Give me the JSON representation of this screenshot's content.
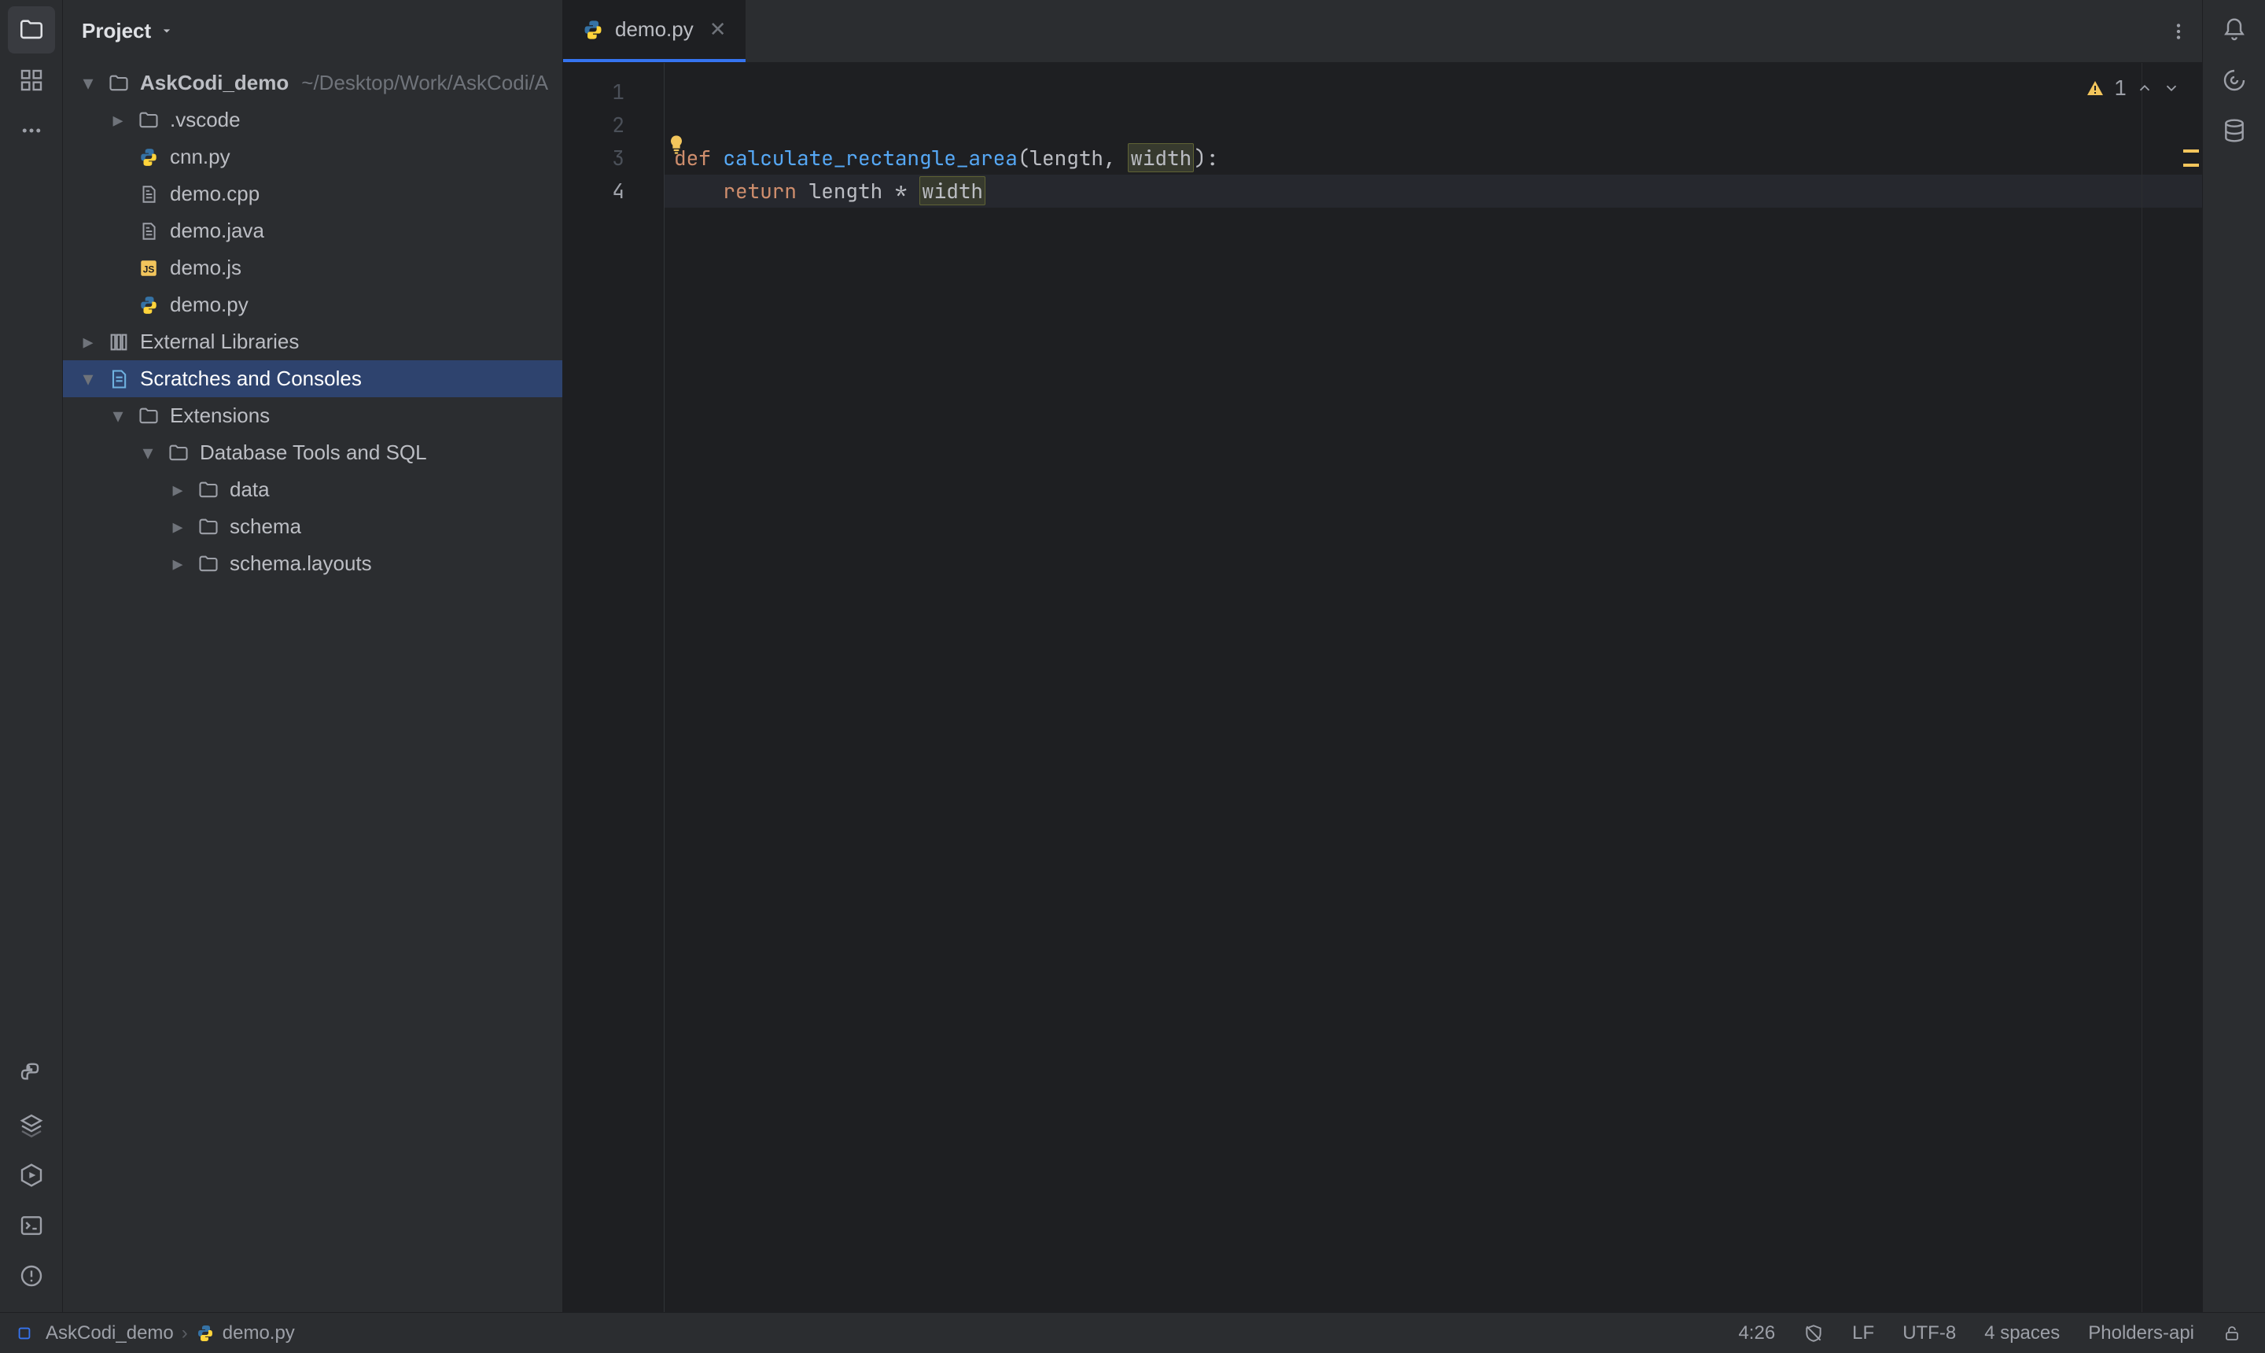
{
  "tree_header": {
    "title": "Project"
  },
  "project": {
    "root": {
      "name": "AskCodi_demo",
      "hint": "~/Desktop/Work/AskCodi/A"
    },
    "vscode": ".vscode",
    "files": {
      "cnn": "cnn.py",
      "cpp": "demo.cpp",
      "java": "demo.java",
      "js": "demo.js",
      "py": "demo.py"
    },
    "ext_libs": "External Libraries",
    "scratches": "Scratches and Consoles",
    "extensions": "Extensions",
    "db_tools": "Database Tools and SQL",
    "data_dir": "data",
    "schema_dir": "schema",
    "schema_layouts_dir": "schema.layouts"
  },
  "tab": {
    "name": "demo.py"
  },
  "gutter": {
    "l1": "1",
    "l2": "2",
    "l3": "3",
    "l4": "4"
  },
  "code": {
    "l3": {
      "kw": "def",
      "fn": "calculate_rectangle_area",
      "open": "(length, ",
      "widthp": "width",
      "close": "):"
    },
    "l4": {
      "indent": "    ",
      "kw": "return",
      "mid": " length * ",
      "width": "width"
    }
  },
  "inspections": {
    "count": "1"
  },
  "breadcrumb": {
    "project": "AskCodi_demo",
    "file": "demo.py"
  },
  "status": {
    "pos": "4:26",
    "sep": "LF",
    "enc": "UTF-8",
    "indent": "4 spaces",
    "api": "Pholders-api"
  }
}
